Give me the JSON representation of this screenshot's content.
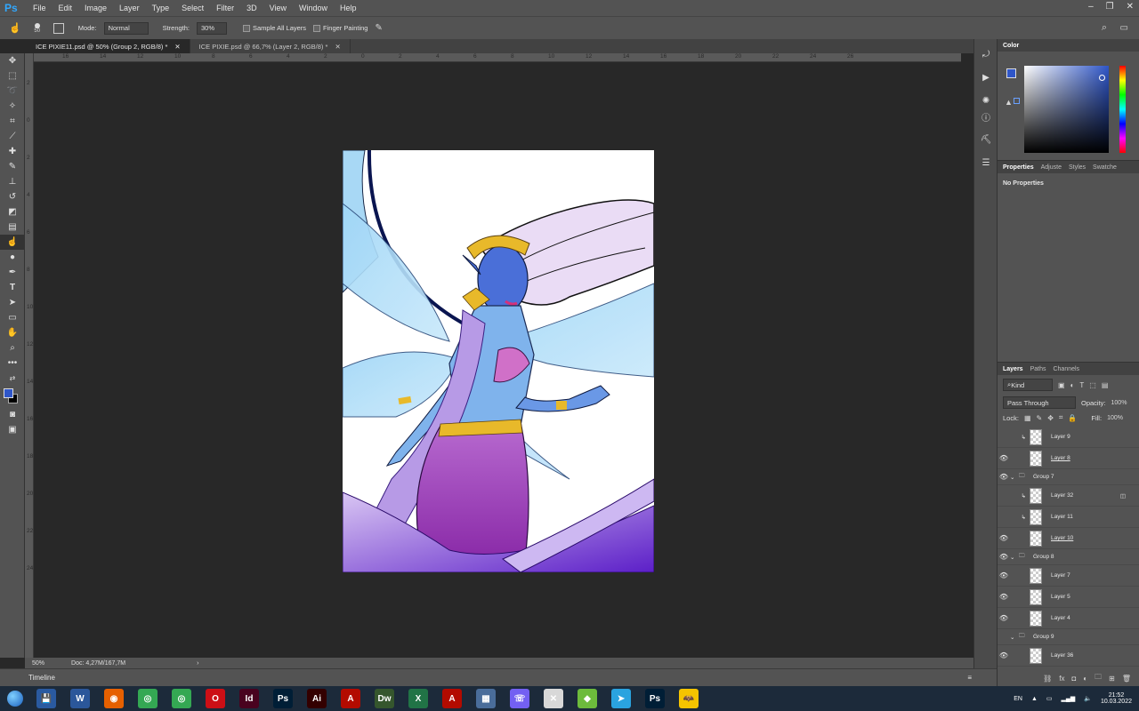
{
  "app": {
    "logo": "Ps"
  },
  "menu": [
    "File",
    "Edit",
    "Image",
    "Layer",
    "Type",
    "Select",
    "Filter",
    "3D",
    "View",
    "Window",
    "Help"
  ],
  "options": {
    "brush_size": "50",
    "mode_label": "Mode:",
    "mode_value": "Normal",
    "strength_label": "Strength:",
    "strength_value": "30%",
    "sample_all": "Sample All Layers",
    "finger_painting": "Finger Painting"
  },
  "tabs": [
    {
      "label": "ICE PIXIE11.psd @ 50% (Group 2, RGB/8) *"
    },
    {
      "label": "ICE PIXIE.psd @ 66,7% (Layer 2, RGB/8) *"
    }
  ],
  "ruler": {
    "top": [
      "16",
      "14",
      "12",
      "10",
      "8",
      "6",
      "4",
      "2",
      "0",
      "2",
      "4",
      "6",
      "8",
      "10",
      "12",
      "14",
      "16",
      "18",
      "20",
      "22",
      "24",
      "26"
    ],
    "left": [
      "2",
      "0",
      "2",
      "4",
      "6",
      "8",
      "10",
      "12",
      "14",
      "16",
      "18",
      "20",
      "22",
      "24"
    ]
  },
  "status": {
    "zoom": "50%",
    "doc": "Doc: 4,27M/167,7M"
  },
  "timeline": {
    "label": "Timeline"
  },
  "color_panel": {
    "title": "Color",
    "foreground": "#2f56c8",
    "background": "#000000"
  },
  "properties_panel": {
    "tabs": [
      "Properties",
      "Adjuste",
      "Styles",
      "Swatche"
    ],
    "message": "No Properties"
  },
  "layers_panel": {
    "tabs": [
      "Layers",
      "Paths",
      "Channels"
    ],
    "filter_label": "Kind",
    "blend_mode": "Pass Through",
    "opacity_label": "Opacity:",
    "opacity_value": "100%",
    "lock_label": "Lock:",
    "fill_label": "Fill:",
    "fill_value": "100%",
    "layers": [
      {
        "name": "Layer 9",
        "visible": false,
        "kind": "clipped"
      },
      {
        "name": "Layer 8",
        "visible": true,
        "kind": "layer",
        "underline": true
      },
      {
        "name": "Group 7",
        "visible": true,
        "kind": "group"
      },
      {
        "name": "Layer 32",
        "visible": false,
        "kind": "clipped"
      },
      {
        "name": "Layer 11",
        "visible": false,
        "kind": "clipped"
      },
      {
        "name": "Layer 10",
        "visible": true,
        "kind": "layer",
        "underline": true
      },
      {
        "name": "Group 8",
        "visible": true,
        "kind": "group"
      },
      {
        "name": "Layer 7",
        "visible": true,
        "kind": "layer"
      },
      {
        "name": "Layer 5",
        "visible": true,
        "kind": "layer"
      },
      {
        "name": "Layer 4",
        "visible": true,
        "kind": "layer"
      },
      {
        "name": "Group 9",
        "visible": false,
        "kind": "group"
      },
      {
        "name": "Layer 36",
        "visible": true,
        "kind": "layer"
      }
    ]
  },
  "taskbar": {
    "lang": "EN",
    "time": "21:52",
    "date": "10.03.2022",
    "apps": [
      {
        "name": "save",
        "glyph": "💾",
        "color": "#2a5aa0"
      },
      {
        "name": "word",
        "glyph": "W",
        "color": "#2b579a"
      },
      {
        "name": "firefox",
        "glyph": "◉",
        "color": "#e66000"
      },
      {
        "name": "chrome",
        "glyph": "◎",
        "color": "#34a853"
      },
      {
        "name": "chrome2",
        "glyph": "◎",
        "color": "#34a853"
      },
      {
        "name": "opera",
        "glyph": "O",
        "color": "#cc0f16"
      },
      {
        "name": "indesign",
        "glyph": "Id",
        "color": "#49021f"
      },
      {
        "name": "photoshop",
        "glyph": "Ps",
        "color": "#001e36"
      },
      {
        "name": "illustrator",
        "glyph": "Ai",
        "color": "#330000"
      },
      {
        "name": "acrobat",
        "glyph": "A",
        "color": "#b30b00"
      },
      {
        "name": "dreamweaver",
        "glyph": "Dw",
        "color": "#35562d"
      },
      {
        "name": "excel",
        "glyph": "X",
        "color": "#217346"
      },
      {
        "name": "acrobat2",
        "glyph": "A",
        "color": "#b30b00"
      },
      {
        "name": "calculator",
        "glyph": "▦",
        "color": "#4a6d9a"
      },
      {
        "name": "viber",
        "glyph": "☏",
        "color": "#7360f2"
      },
      {
        "name": "app16",
        "glyph": "✕",
        "color": "#d8d8d8"
      },
      {
        "name": "bluestacks",
        "glyph": "◆",
        "color": "#6dbb3c"
      },
      {
        "name": "telegram",
        "glyph": "➤",
        "color": "#2aa3df"
      },
      {
        "name": "photoshop2",
        "glyph": "Ps",
        "color": "#001e36"
      },
      {
        "name": "batman",
        "glyph": "🦇",
        "color": "#f5c400"
      }
    ]
  }
}
